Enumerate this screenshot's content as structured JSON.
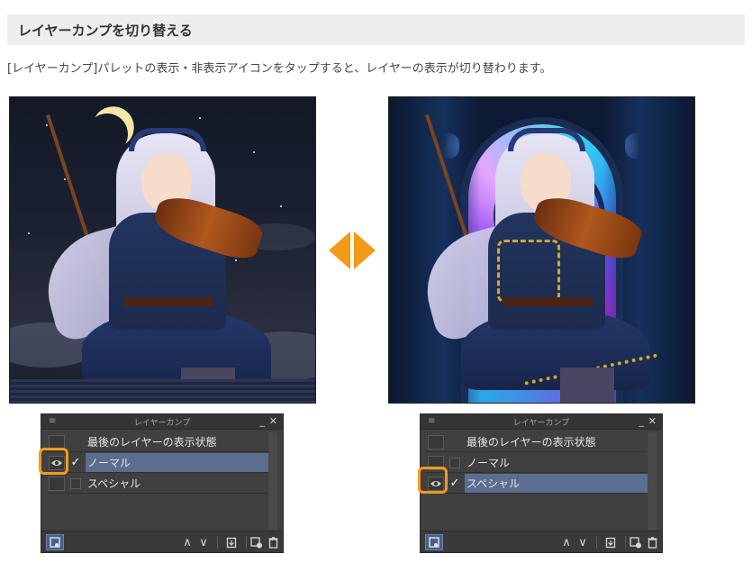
{
  "heading": "レイヤーカンプを切り替える",
  "description": "[レイヤーカンプ]パレットの表示・非表示アイコンをタップすると、レイヤーの表示が切り替わります。",
  "colors": {
    "accent": "#f49a19",
    "panel_bg": "#404040",
    "selected_row": "#5b6e90",
    "heading_bg": "#eeeeee"
  },
  "panels": [
    {
      "title": "レイヤーカンプ",
      "menu_icon": "hamburger-icon",
      "minimize": "_",
      "close": "✕",
      "rows": [
        {
          "label": "最後のレイヤーの表示状態",
          "visible": false,
          "checked": false,
          "selected": false
        },
        {
          "label": "ノーマル",
          "visible": true,
          "checked": true,
          "selected": true
        },
        {
          "label": "スペシャル",
          "visible": false,
          "checked": false,
          "selected": false
        }
      ]
    },
    {
      "title": "レイヤーカンプ",
      "menu_icon": "hamburger-icon",
      "minimize": "_",
      "close": "✕",
      "rows": [
        {
          "label": "最後のレイヤーの表示状態",
          "visible": false,
          "checked": false,
          "selected": false
        },
        {
          "label": "ノーマル",
          "visible": false,
          "checked": false,
          "selected": false
        },
        {
          "label": "スペシャル",
          "visible": true,
          "checked": true,
          "selected": true
        }
      ]
    }
  ],
  "toolbar_icons": [
    "preview-icon",
    "move-up-icon",
    "move-down-icon",
    "copy-icon",
    "new-layer-comp-icon",
    "delete-icon"
  ]
}
